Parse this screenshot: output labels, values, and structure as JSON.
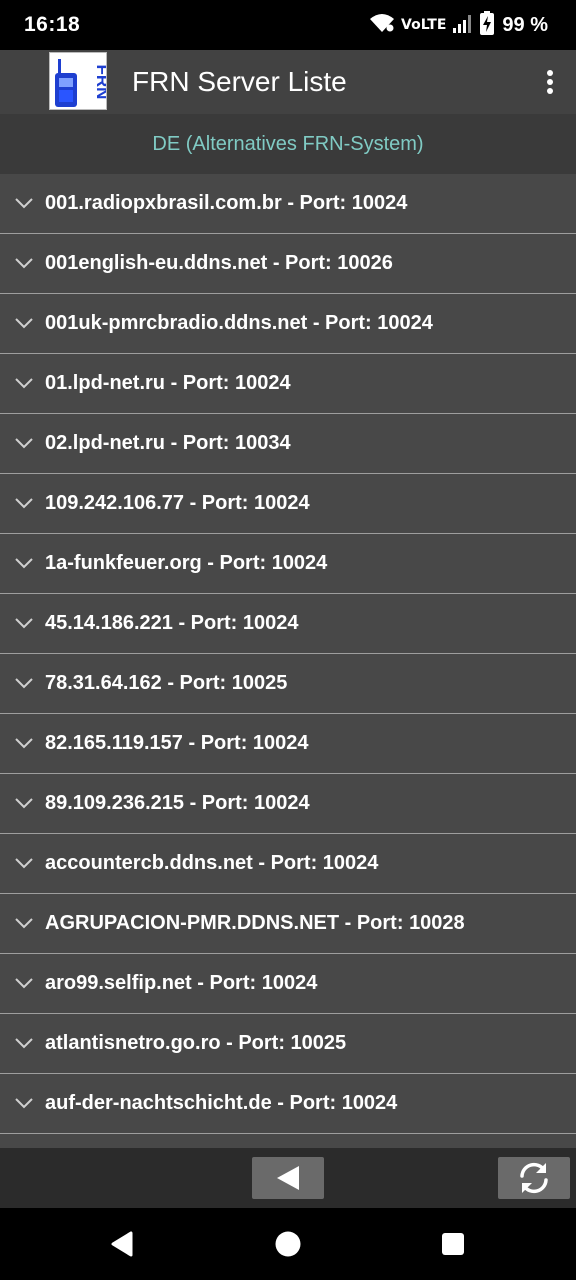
{
  "status_bar": {
    "time": "16:18",
    "network": "VoLTE",
    "battery": "99 %",
    "icons": [
      "wifi-icon",
      "signal-icon",
      "battery-charging-icon"
    ]
  },
  "app_bar": {
    "logo_text": "FRN",
    "title": "FRN Server Liste",
    "menu_icon": "more-vert-icon"
  },
  "filter": {
    "label": "DE (Alternatives FRN-System)"
  },
  "servers": [
    {
      "label": "001.radiopxbrasil.com.br - Port: 10024"
    },
    {
      "label": "001english-eu.ddns.net - Port: 10026"
    },
    {
      "label": "001uk-pmrcbradio.ddns.net - Port: 10024"
    },
    {
      "label": "01.lpd-net.ru - Port: 10024"
    },
    {
      "label": "02.lpd-net.ru - Port: 10034"
    },
    {
      "label": "109.242.106.77 - Port: 10024"
    },
    {
      "label": "1a-funkfeuer.org - Port: 10024"
    },
    {
      "label": "45.14.186.221 - Port: 10024"
    },
    {
      "label": "78.31.64.162 - Port: 10025"
    },
    {
      "label": "82.165.119.157 - Port: 10024"
    },
    {
      "label": "89.109.236.215 - Port: 10024"
    },
    {
      "label": "accountercb.ddns.net - Port: 10024"
    },
    {
      "label": "AGRUPACION-PMR.DDNS.NET - Port: 10028"
    },
    {
      "label": "aro99.selfip.net - Port: 10024"
    },
    {
      "label": "atlantisnetro.go.ro - Port: 10025"
    },
    {
      "label": "auf-der-nachtschicht.de - Port: 10024"
    },
    {
      "label": ""
    }
  ],
  "bottom_bar": {
    "back_icon": "back-triangle-icon",
    "refresh_icon": "refresh-icon"
  },
  "colors": {
    "accent": "#80cbc4",
    "app_bar": "#424242",
    "list_bg": "#484848",
    "divider": "#9e9e9e"
  }
}
